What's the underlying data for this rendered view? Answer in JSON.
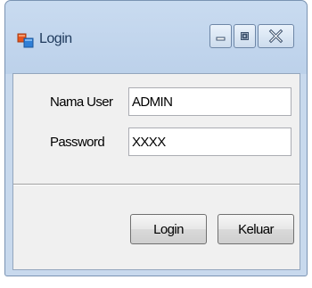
{
  "window": {
    "title": "Login",
    "icon": "form-app-icon",
    "controls": [
      "minimize-icon",
      "maximize-icon",
      "close-icon"
    ]
  },
  "form": {
    "username_label": "Nama User",
    "username_value": "ADMIN",
    "password_label": "Password",
    "password_value": "XXXX"
  },
  "buttons": {
    "login_label": "Login",
    "exit_label": "Keluar"
  }
}
